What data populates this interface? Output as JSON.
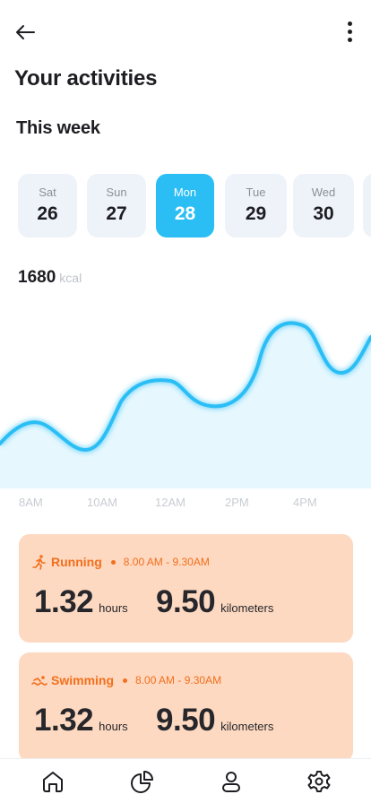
{
  "header": {
    "title": "Your activities",
    "section": "This week"
  },
  "days": [
    {
      "name": "Sat",
      "num": "26"
    },
    {
      "name": "Sun",
      "num": "27"
    },
    {
      "name": "Mon",
      "num": "28"
    },
    {
      "name": "Tue",
      "num": "29"
    },
    {
      "name": "Wed",
      "num": "30"
    }
  ],
  "selected_day": "Mon",
  "calories": {
    "value": "1680",
    "unit": "kcal"
  },
  "chart_data": {
    "type": "area",
    "x_ticks": [
      "8AM",
      "10AM",
      "12AM",
      "2PM",
      "4PM"
    ],
    "color": "#2bbef5",
    "fill_color": "#e6f7fe"
  },
  "activities": [
    {
      "name": "Running",
      "icon": "running-icon",
      "time": "8.00 AM - 9.30AM",
      "duration": "1.32",
      "duration_unit": "hours",
      "distance": "9.50",
      "distance_unit": "kilometers"
    },
    {
      "name": "Swimming",
      "icon": "swimming-icon",
      "time": "8.00 AM - 9.30AM",
      "duration": "1.32",
      "duration_unit": "hours",
      "distance": "9.50",
      "distance_unit": "kilometers"
    }
  ],
  "nav": [
    "home-icon",
    "chart-pie-icon",
    "profile-icon",
    "settings-icon"
  ],
  "colors": {
    "accent": "#2bbef5",
    "card_bg": "#fdd9c1",
    "card_accent": "#f26f1c"
  }
}
